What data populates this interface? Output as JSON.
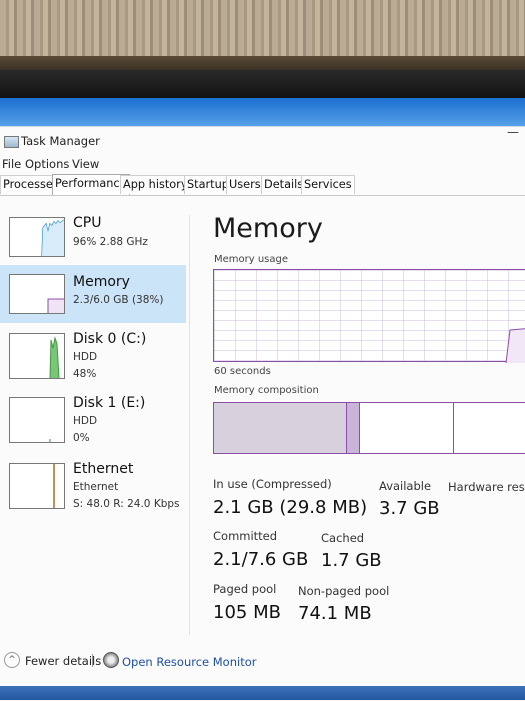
{
  "window": {
    "title": "Task Manager"
  },
  "menu": [
    "File",
    "Options",
    "View"
  ],
  "tabs": [
    "Processes",
    "Performance",
    "App history",
    "Startup",
    "Users",
    "Details",
    "Services"
  ],
  "active_tab": "Performance",
  "sidebar": {
    "items": [
      {
        "name": "CPU",
        "sub1": "96% 2.88 GHz",
        "sub2": "",
        "selected": false
      },
      {
        "name": "Memory",
        "sub1": "2.3/6.0 GB (38%)",
        "sub2": "",
        "selected": true
      },
      {
        "name": "Disk 0 (C:)",
        "sub1": "HDD",
        "sub2": "48%",
        "selected": false
      },
      {
        "name": "Disk 1 (E:)",
        "sub1": "HDD",
        "sub2": "0%",
        "selected": false
      },
      {
        "name": "Ethernet",
        "sub1": "Ethernet",
        "sub2": "S: 48.0 R: 24.0 Kbps",
        "selected": false
      }
    ]
  },
  "main": {
    "title": "Memory",
    "usage_label": "Memory usage",
    "seconds_label": "60 seconds",
    "composition_label": "Memory composition",
    "stats": {
      "in_use_label": "In use (Compressed)",
      "in_use_value": "2.1 GB (29.8 MB)",
      "available_label": "Available",
      "available_value": "3.7 GB",
      "hardware_label": "Hardware rese",
      "committed_label": "Committed",
      "committed_value": "2.1/7.6 GB",
      "cached_label": "Cached",
      "cached_value": "1.7 GB",
      "paged_label": "Paged pool",
      "paged_value": "105 MB",
      "nonpaged_label": "Non-paged pool",
      "nonpaged_value": "74.1 MB"
    }
  },
  "footer": {
    "fewer_details": "Fewer details",
    "open_resource_monitor": "Open Resource Monitor"
  },
  "colors": {
    "memory_accent": "#8c4fa8",
    "selected_bg": "#cce4f7",
    "link": "#1d4fa3"
  }
}
